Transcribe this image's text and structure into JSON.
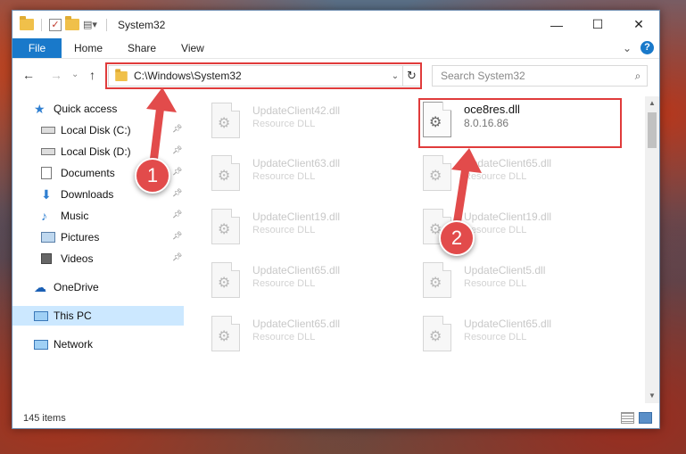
{
  "window": {
    "title": "System32",
    "controls": {
      "minimize": "—",
      "maximize": "☐",
      "close": "✕"
    }
  },
  "ribbon": {
    "file": "File",
    "tabs": [
      "Home",
      "Share",
      "View"
    ],
    "expand": "⌄",
    "help": "?"
  },
  "nav": {
    "back": "←",
    "forward": "→",
    "recent": "⌄",
    "up": "↑",
    "address": "C:\\Windows\\System32",
    "address_dropdown": "⌄",
    "refresh": "↻",
    "search_placeholder": "Search System32",
    "search_icon": "⌕"
  },
  "sidebar": {
    "items": [
      {
        "label": "Quick access",
        "icon": "star-icon"
      },
      {
        "label": "Local Disk (C:)",
        "icon": "drive-icon",
        "pinned": true
      },
      {
        "label": "Local Disk (D:)",
        "icon": "drive-icon",
        "pinned": true
      },
      {
        "label": "Documents",
        "icon": "documents-icon",
        "pinned": true
      },
      {
        "label": "Downloads",
        "icon": "downloads-icon",
        "pinned": true
      },
      {
        "label": "Music",
        "icon": "music-icon",
        "pinned": true
      },
      {
        "label": "Pictures",
        "icon": "pictures-icon",
        "pinned": true
      },
      {
        "label": "Videos",
        "icon": "videos-icon",
        "pinned": true
      },
      {
        "label": "OneDrive",
        "icon": "cloud-icon"
      },
      {
        "label": "This PC",
        "icon": "pc-icon",
        "selected": true
      },
      {
        "label": "Network",
        "icon": "network-icon"
      }
    ]
  },
  "files": {
    "left_column": [
      {
        "name": "UpdateClient42.dll",
        "type": "Resource DLL"
      },
      {
        "name": "UpdateClient63.dll",
        "type": "Resource DLL"
      },
      {
        "name": "UpdateClient19.dll",
        "type": "Resource DLL"
      },
      {
        "name": "UpdateClient65.dll",
        "type": "Resource DLL"
      },
      {
        "name": "UpdateClient65.dll",
        "type": "Resource DLL"
      }
    ],
    "right_column": [
      {
        "name": "oce8res.dll",
        "type": "8.0.16.86",
        "highlighted": true
      },
      {
        "name": "UpdateClient65.dll",
        "type": "Resource DLL"
      },
      {
        "name": "UpdateClient19.dll",
        "type": "Resource DLL"
      },
      {
        "name": "UpdateClient5.dll",
        "type": "Resource DLL"
      },
      {
        "name": "UpdateClient65.dll",
        "type": "Resource DLL"
      }
    ]
  },
  "status": {
    "item_count": "145 items"
  },
  "markers": [
    "1",
    "2"
  ],
  "colors": {
    "accent": "#1979ca",
    "annotation": "#e03b3b",
    "selection": "#cce8ff"
  }
}
